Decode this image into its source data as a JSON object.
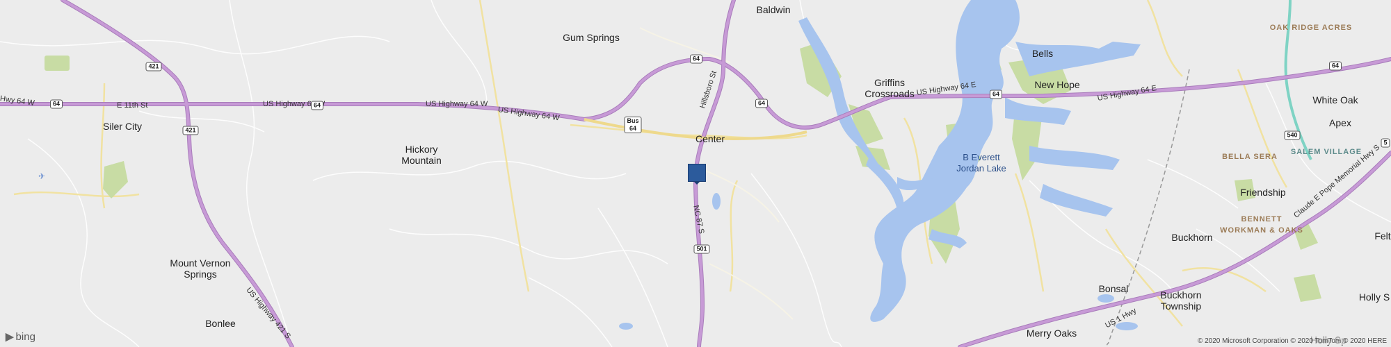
{
  "map": {
    "place_labels": [
      {
        "id": "baldwin",
        "text": "Baldwin"
      },
      {
        "id": "gum-springs",
        "text": "Gum Springs"
      },
      {
        "id": "siler-city",
        "text": "Siler City"
      },
      {
        "id": "hickory-mountain",
        "text": "Hickory\nMountain"
      },
      {
        "id": "center",
        "text": "Center"
      },
      {
        "id": "griffins-crossroads",
        "text": "Griffins\nCrossroads"
      },
      {
        "id": "bells",
        "text": "Bells"
      },
      {
        "id": "new-hope",
        "text": "New Hope"
      },
      {
        "id": "white-oak",
        "text": "White Oak"
      },
      {
        "id": "apex",
        "text": "Apex"
      },
      {
        "id": "friendship",
        "text": "Friendship"
      },
      {
        "id": "buckhorn",
        "text": "Buckhorn"
      },
      {
        "id": "mount-vernon-springs",
        "text": "Mount Vernon\nSprings"
      },
      {
        "id": "bonlee",
        "text": "Bonlee"
      },
      {
        "id": "bonsal",
        "text": "Bonsal"
      },
      {
        "id": "buckhorn-township",
        "text": "Buckhorn\nTownship"
      },
      {
        "id": "merry-oaks",
        "text": "Merry Oaks"
      },
      {
        "id": "holly-springs",
        "text": "Holly S"
      },
      {
        "id": "felt",
        "text": "Felt"
      },
      {
        "id": "holly-sp-bottom",
        "text": "Holly Sp"
      }
    ],
    "water_labels": [
      {
        "id": "jordan-lake",
        "text": "B Everett\nJordan Lake"
      }
    ],
    "area_labels": [
      {
        "id": "oak-ridge-acres",
        "text": "OAK RIDGE ACRES"
      },
      {
        "id": "bella-sera",
        "text": "BELLA SERA"
      },
      {
        "id": "salem-village",
        "text": "SALEM VILLAGE"
      },
      {
        "id": "bennett-workman-oaks",
        "text": "BENNETT\nWORKMAN & OAKS"
      }
    ],
    "road_labels": [
      {
        "id": "e-11th-st",
        "text": "E 11th St"
      },
      {
        "id": "us64w-left",
        "text": "Hwy 64 W"
      },
      {
        "id": "us64w-mid",
        "text": "US Highway 64 W"
      },
      {
        "id": "us64w-right",
        "text": "US Highway 64 W"
      },
      {
        "id": "us64e",
        "text": "US Highway 64 E"
      },
      {
        "id": "us64e-right",
        "text": "US Highway 64 E"
      },
      {
        "id": "hillsboro-st",
        "text": "Hillsboro St"
      },
      {
        "id": "nc87s",
        "text": "NC 87 S"
      },
      {
        "id": "us421s",
        "text": "US Highway 421 S"
      },
      {
        "id": "us1hwy",
        "text": "US 1 Hwy"
      },
      {
        "id": "claude-pope",
        "text": "Claude E Pope Memorial Hwy S"
      }
    ],
    "shields": [
      {
        "id": "s421-top",
        "text": "421"
      },
      {
        "id": "s421-mid",
        "text": "421"
      },
      {
        "id": "s64-left",
        "text": "64"
      },
      {
        "id": "s64-mid",
        "text": "64"
      },
      {
        "id": "s64-top",
        "text": "64"
      },
      {
        "id": "s64-right",
        "text": "64"
      },
      {
        "id": "s64-lake",
        "text": "64"
      },
      {
        "id": "s64-far",
        "text": "64"
      },
      {
        "id": "sbus64",
        "text": "Bus\n64"
      },
      {
        "id": "s501",
        "text": "501"
      },
      {
        "id": "s540",
        "text": "540"
      },
      {
        "id": "s5",
        "text": "5"
      }
    ],
    "pin": {
      "label": "location-marker"
    },
    "brand": {
      "logo": "bing"
    },
    "copyright": "© 2020 Microsoft Corporation © 2020 TomTom © 2020 HERE",
    "colors": {
      "background": "#ececec",
      "water": "#a7c4ee",
      "park": "#c8dca4",
      "highway": "#c79ad6",
      "highway_outline": "#a97dbb",
      "arterial": "#f1e2a1",
      "minor_road": "#ffffff",
      "pin": "#2c5b9c",
      "turnpike": "#7fd3c4"
    }
  }
}
